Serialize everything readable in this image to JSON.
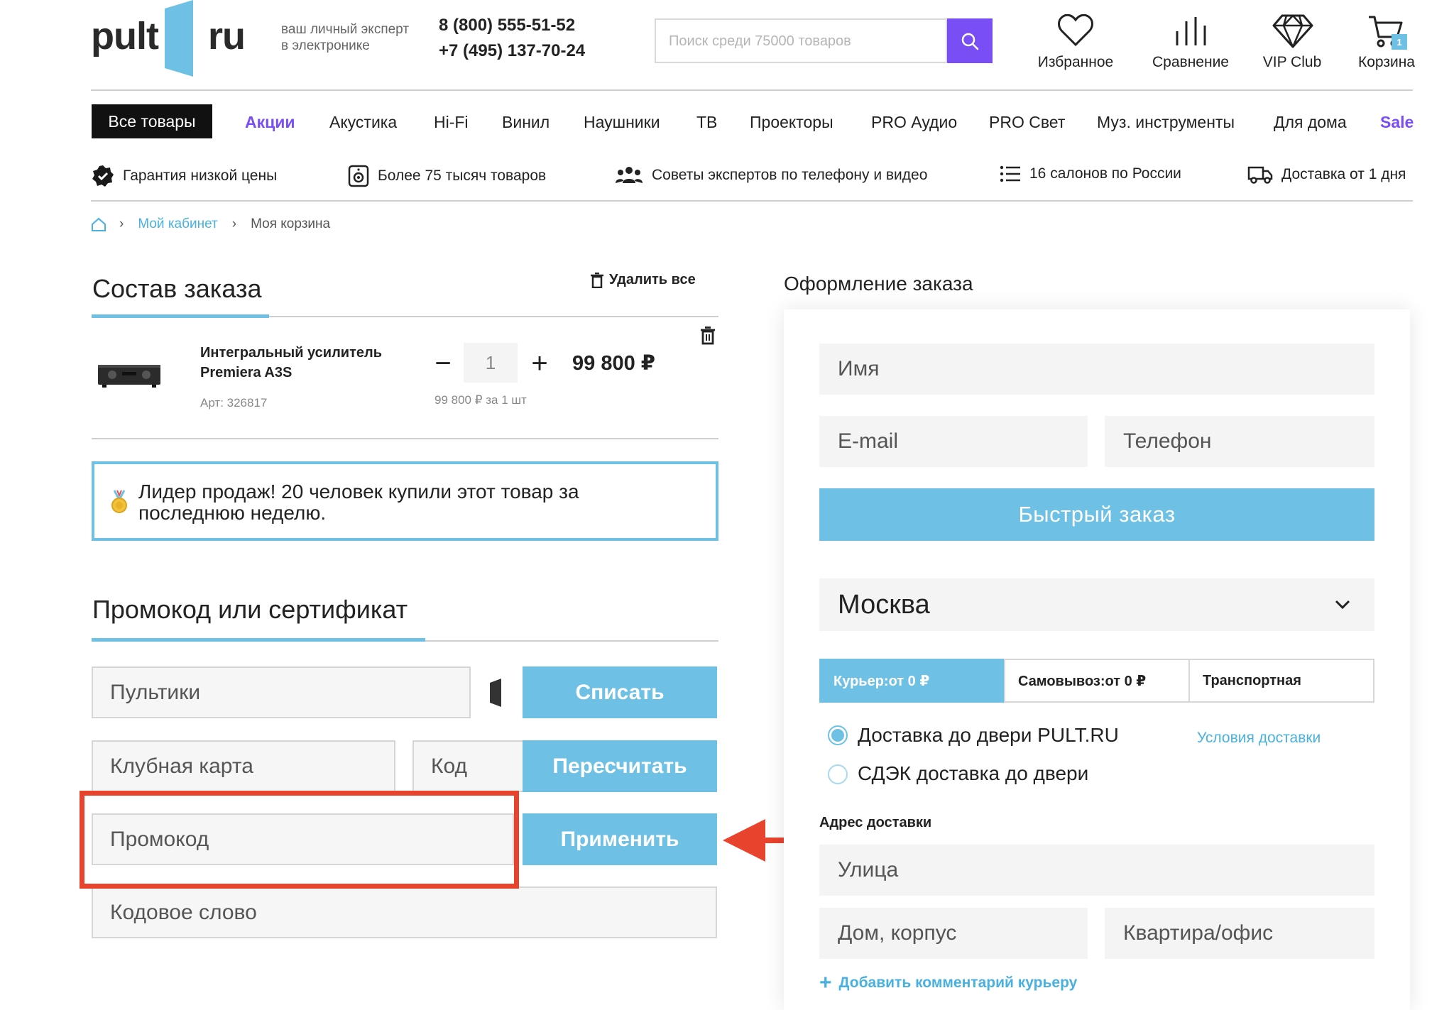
{
  "header": {
    "logo_left": "pult",
    "logo_right": "ru",
    "tagline_line1": "ваш личный эксперт",
    "tagline_line2": "в электронике",
    "phone1": "8 (800) 555-51-52",
    "phone2": "+7 (495) 137-70-24",
    "search_placeholder": "Поиск среди 75000 товаров",
    "favorites_label": "Избранное",
    "compare_label": "Сравнение",
    "vip_label": "VIP Club",
    "cart_label": "Корзина",
    "cart_count": "1"
  },
  "nav": {
    "all_label": "Все товары",
    "items": [
      "Акции",
      "Акустика",
      "Hi-Fi",
      "Винил",
      "Наушники",
      "ТВ",
      "Проекторы",
      "PRO Аудио",
      "PRO Свет",
      "Муз. инструменты",
      "Для дома",
      "Sale"
    ]
  },
  "benefits": [
    "Гарантия низкой цены",
    "Более 75 тысяч товаров",
    "Советы экспертов по телефону и видео",
    "16 салонов по России",
    "Доставка от 1 дня"
  ],
  "breadcrumbs": {
    "cabinet": "Мой кабинет",
    "current": "Моя корзина"
  },
  "order": {
    "title": "Состав заказа",
    "delete_all": "Удалить все",
    "product": {
      "name_line1": "Интегральный усилитель",
      "name_line2": "Premiera A3S",
      "article": "Арт: 326817",
      "qty": "1",
      "minus": "−",
      "plus": "+",
      "price": "99 800 ₽",
      "unit_price": "99 800 ₽ за 1 шт"
    },
    "leader_line1": "Лидер продаж! 20 человек купили этот товар за",
    "leader_line2": "последнюю неделю."
  },
  "promo": {
    "title": "Промокод или сертификат",
    "pultiki_placeholder": "Пультики",
    "writeoff_button": "Списать",
    "club_card_placeholder": "Клубная карта",
    "code_placeholder": "Код",
    "recalc_button": "Пересчитать",
    "promocode_placeholder": "Промокод",
    "apply_button": "Применить",
    "codeword_placeholder": "Кодовое слово"
  },
  "checkout": {
    "title": "Оформление заказа",
    "name_placeholder": "Имя",
    "email_placeholder": "E-mail",
    "phone_placeholder": "Телефон",
    "quick_order_button": "Быстрый заказ",
    "city": "Москва",
    "tabs": [
      "Курьер:от 0 ₽",
      "Самовывоз:от 0 ₽",
      "Транспортная"
    ],
    "delivery_options": [
      "Доставка до двери PULT.RU",
      "СДЭК доставка до двери"
    ],
    "delivery_terms_link": "Условия доставки",
    "address_label": "Адрес доставки",
    "street_placeholder": "Улица",
    "house_placeholder": "Дом, корпус",
    "apartment_placeholder": "Квартира/офис",
    "add_comment": "Добавить комментарий курьеру"
  },
  "colors": {
    "accent_blue": "#6ec1e4",
    "accent_purple": "#7a4ef5",
    "highlight_red": "#e8432d"
  }
}
